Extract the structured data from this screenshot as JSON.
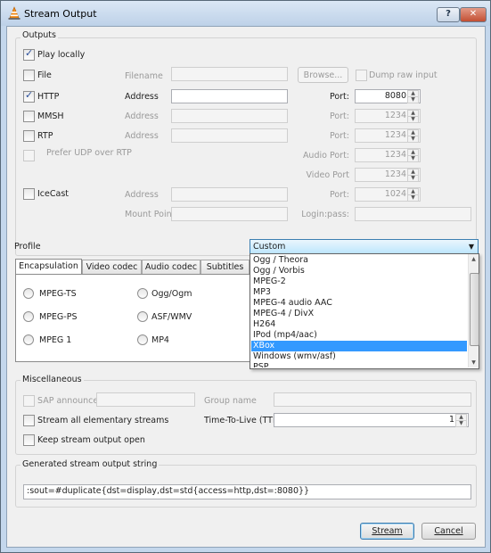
{
  "window": {
    "title": "Stream Output",
    "help_label": "?",
    "close_label": "✕"
  },
  "outputs": {
    "group_title": "Outputs",
    "play_locally": {
      "label": "Play locally",
      "checked": true
    },
    "file": {
      "label": "File",
      "filename_label": "Filename",
      "filename_value": "",
      "browse_label": "Browse...",
      "dump_raw_label": "Dump raw input"
    },
    "http": {
      "label": "HTTP",
      "address_label": "Address",
      "address_value": "",
      "port_label": "Port:",
      "port_value": "8080"
    },
    "mmsh": {
      "label": "MMSH",
      "address_label": "Address",
      "address_value": "",
      "port_label": "Port:",
      "port_value": "1234"
    },
    "rtp": {
      "label": "RTP",
      "address_label": "Address",
      "address_value": "",
      "port_label": "Port:",
      "port_value": "1234",
      "prefer_udp_label": "Prefer UDP over RTP",
      "audio_port_label": "Audio Port:",
      "audio_port_value": "1234",
      "video_port_label": "Video Port",
      "video_port_value": "1234"
    },
    "icecast": {
      "label": "IceCast",
      "address_label": "Address",
      "address_value": "",
      "port_label": "Port:",
      "port_value": "1024",
      "mount_point_label": "Mount Point",
      "mount_point_value": "",
      "login_label": "Login:pass:",
      "login_value": ""
    }
  },
  "profile": {
    "label": "Profile",
    "selected": "Custom",
    "options": [
      "Ogg / Theora",
      "Ogg / Vorbis",
      "MPEG-2",
      "MP3",
      "MPEG-4 audio AAC",
      "MPEG-4 / DivX",
      "H264",
      "IPod (mp4/aac)",
      "XBox",
      "Windows (wmv/asf)",
      "PSP"
    ],
    "highlighted": "XBox",
    "tabs": [
      "Encapsulation",
      "Video codec",
      "Audio codec",
      "Subtitles"
    ],
    "active_tab": "Encapsulation",
    "encapsulation": [
      "MPEG-TS",
      "MPEG-PS",
      "MPEG 1",
      "Ogg/Ogm",
      "ASF/WMV",
      "MP4"
    ]
  },
  "misc": {
    "group_title": "Miscellaneous",
    "sap_label": "SAP announce",
    "sap_value": "",
    "group_name_label": "Group name",
    "group_name_value": "",
    "stream_all_label": "Stream all elementary streams",
    "ttl_label": "Time-To-Live (TTL)",
    "ttl_value": "1",
    "keep_open_label": "Keep stream output open"
  },
  "generated": {
    "group_title": "Generated stream output string",
    "value": ":sout=#duplicate{dst=display,dst=std{access=http,dst=:8080}}"
  },
  "buttons": {
    "stream": "Stream",
    "cancel": "Cancel"
  },
  "colors": {
    "selection": "#3399ff",
    "titlebar": "#c4d7ec",
    "close_button": "#c34f33"
  }
}
